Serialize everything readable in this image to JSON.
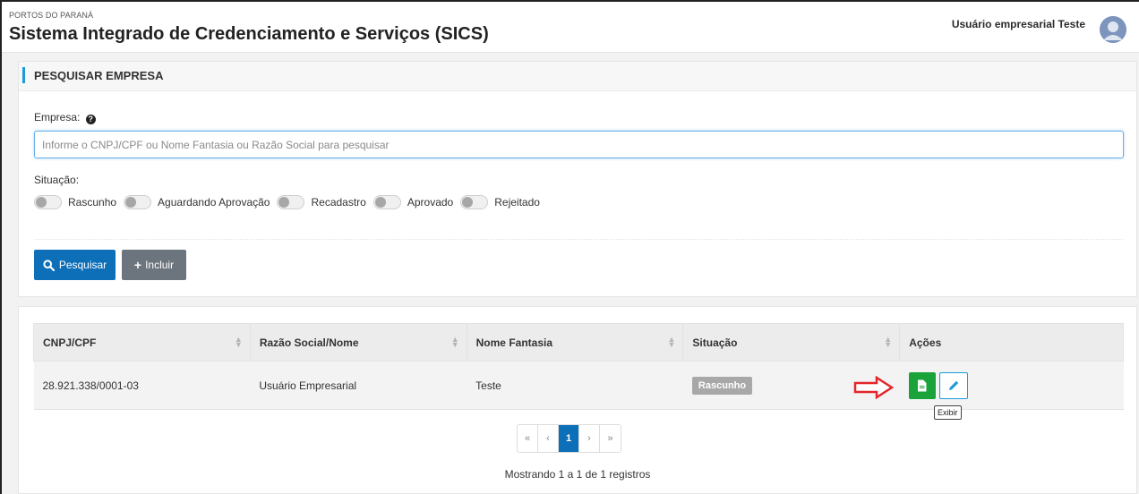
{
  "header": {
    "org": "PORTOS DO PARANÁ",
    "title": "Sistema Integrado de Credenciamento e Serviços (SICS)",
    "user": "Usuário empresarial Teste"
  },
  "search": {
    "section_title": "PESQUISAR EMPRESA",
    "empresa_label": "Empresa:",
    "placeholder": "Informe o CNPJ/CPF ou Nome Fantasia ou Razão Social para pesquisar",
    "situacao_label": "Situação:",
    "toggles": [
      "Rascunho",
      "Aguardando Aprovação",
      "Recadastro",
      "Aprovado",
      "Rejeitado"
    ],
    "btn_pesquisar": "Pesquisar",
    "btn_incluir": "Incluir"
  },
  "table": {
    "headers": [
      "CNPJ/CPF",
      "Razão Social/Nome",
      "Nome Fantasia",
      "Situação",
      "Ações"
    ],
    "rows": [
      {
        "cnpj": "28.921.338/0001-03",
        "razao": "Usuário Empresarial",
        "fantasia": "Teste",
        "situacao": "Rascunho"
      }
    ],
    "tooltip": "Exibir"
  },
  "pager": {
    "first": "«",
    "prev": "‹",
    "current": "1",
    "next": "›",
    "last": "»",
    "showing": "Mostrando 1 a 1 de 1 registros"
  },
  "colors": {
    "primary": "#0d6fb8",
    "success": "#1aa23b",
    "accent": "#1a9bd7",
    "annotation_arrow": "#e3262b"
  }
}
